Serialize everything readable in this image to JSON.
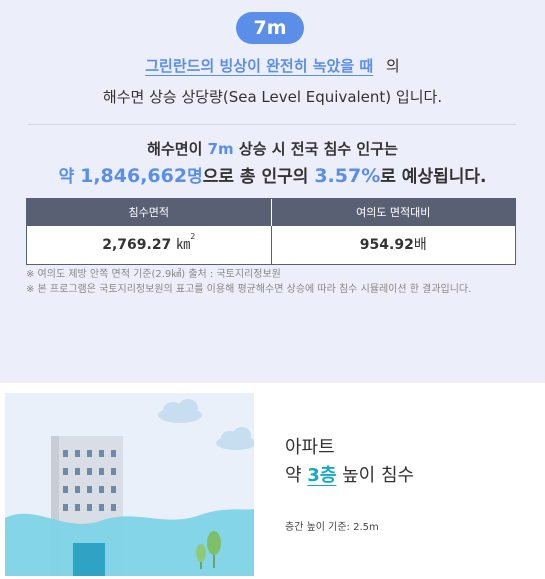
{
  "summary": {
    "level_badge": "7m",
    "headline_link": "그린란드의 빙상이 완전히 녹았을 때",
    "headline_suffix": "의",
    "headline_line2": "해수면 상승 상당량(Sea Level Equivalent) 입니다.",
    "result_prefix": "해수면이",
    "result_level": "7m",
    "result_suffix": "상승 시 전국 침수 인구는",
    "result_approx": "약",
    "population": "1,846,662",
    "population_unit": "명",
    "mid_text": "으로 총 인구의",
    "percent": "3.57%",
    "end_text": "로 예상됩니다."
  },
  "table": {
    "headers": [
      "침수면적",
      "여의도 면적대비"
    ],
    "area_value": "2,769.27",
    "area_unit": "㎞",
    "area_sup": "2",
    "ratio_value": "954.92",
    "ratio_unit": "배"
  },
  "notes": [
    "※ 여의도 제방 안쪽 면적 기준(2.9㎢) 출처 : 국토지리정보원",
    "※ 본 프로그램은 국토지리정보원의 표고를 이용해 평균해수면 상승에 따라 침수 시뮬레이션 한 결과입니다."
  ],
  "card": {
    "building_type": "아파트",
    "approx": "약",
    "floors": "3층",
    "flood_suffix": "높이 침수",
    "floor_height_note": "층간 높이 기준: 2.5m"
  },
  "colors": {
    "accent": "#5b8ee8",
    "table_header": "#5a6074",
    "water": "#7ed3e6",
    "floor_accent": "#17a8c8"
  },
  "icons": [
    "building-illustration",
    "cloud-icon",
    "tree-icon"
  ]
}
